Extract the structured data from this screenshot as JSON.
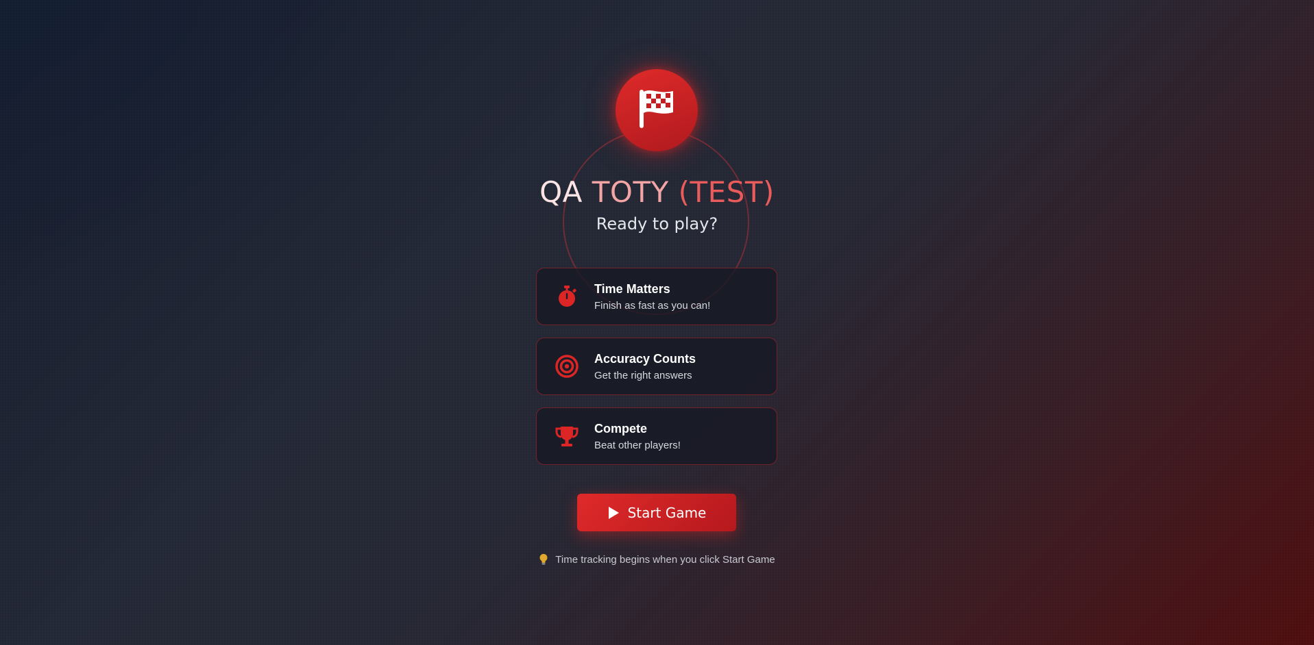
{
  "logo": {
    "icon": "checkered-flag-icon"
  },
  "title": {
    "part1": "QA ",
    "part2": "TOTY ",
    "part3": "(TEST)"
  },
  "subtitle": "Ready to play?",
  "features": [
    {
      "icon": "stopwatch-icon",
      "title": "Time Matters",
      "description": "Finish as fast as you can!"
    },
    {
      "icon": "target-icon",
      "title": "Accuracy Counts",
      "description": "Get the right answers"
    },
    {
      "icon": "trophy-icon",
      "title": "Compete",
      "description": "Beat other players!"
    }
  ],
  "start_button": {
    "label": "Start Game",
    "icon": "play-icon"
  },
  "hint": {
    "icon": "lightbulb-icon",
    "text": "Time tracking begins when you click Start Game"
  },
  "colors": {
    "accent": "#dc2626",
    "accent_dark": "#b91c1c",
    "background": "#232836",
    "hint_bulb": "#e0a82e"
  }
}
